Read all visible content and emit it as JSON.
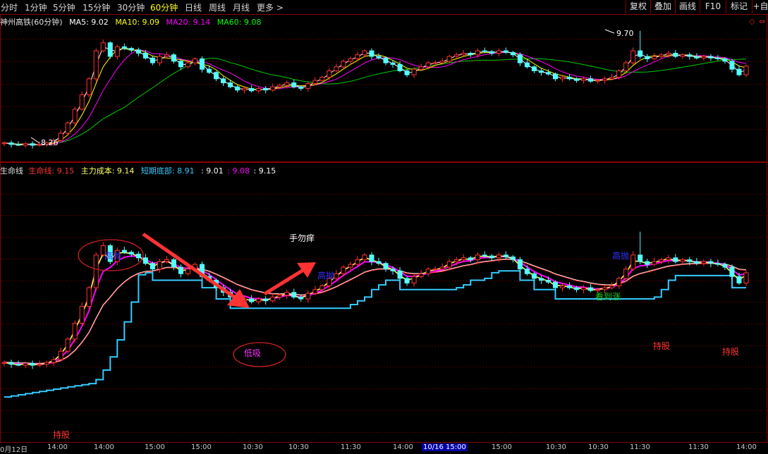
{
  "toolbar": {
    "tabs": [
      "分时",
      "1分钟",
      "5分钟",
      "15分钟",
      "30分钟",
      "60分钟",
      "日线",
      "周线",
      "月线",
      "更多 >"
    ],
    "active_tab": "60分钟",
    "buttons": [
      "复权",
      "叠加",
      "画线",
      "F10",
      "标记",
      "+自"
    ]
  },
  "price_panel": {
    "title": "神州高铁(60分钟)",
    "ma": [
      {
        "label": "MA5: 9.02",
        "color": "#ffffff"
      },
      {
        "label": "MA10: 9.09",
        "color": "#ffff00"
      },
      {
        "label": "MA20: 9.14",
        "color": "#ff00ff"
      },
      {
        "label": "MA60: 9.08",
        "color": "#00ff00"
      }
    ],
    "low_marker": "8.26",
    "high_marker": "9.70"
  },
  "indicator_panel": {
    "name": "生命线",
    "items": [
      {
        "label": "生命线: 9.15",
        "color": "#ff3333"
      },
      {
        "label": "主力成本: 9.14",
        "color": "#ffff66"
      },
      {
        "label": "短期底部: 8.91",
        "color": "#33ccff"
      },
      {
        "label": ": 9.01",
        "color": "#ffffff"
      },
      {
        "label": ": 9.08",
        "color": "#ff00ff"
      },
      {
        "label": ": 9.15",
        "color": "#ffffff"
      }
    ]
  },
  "annotations": {
    "high_sell_1": "高抛",
    "low_buy": "低吸",
    "high_sell_2": "高抛",
    "high_sell_3": "高抛",
    "dont_itch": "手勿痒",
    "see_rise": "看到涨",
    "hold_1": "持股",
    "hold_2": "持股",
    "hold_3": "持股"
  },
  "date_axis": [
    "0月12日",
    "14:00",
    "14:00",
    "15:00",
    "15:00",
    "10:30",
    "10:30",
    "11:30",
    "14:00",
    "10/16 15:00",
    "15:00",
    "10:30",
    "10:30",
    "11:30",
    "11:30",
    "14:00"
  ],
  "date_axis_highlight": "10/16 15:00",
  "colors": {
    "up": "#ff3232",
    "down": "#54ffff",
    "life": "#ff3333",
    "cost": "#ffff66",
    "support": "#33ccff",
    "ma20": "#ff00ff",
    "ma60": "#00cc00",
    "frame": "#8b0000",
    "arrow": "#ff3333"
  },
  "chart_data": {
    "type": "candlestick",
    "closes": [
      8.3,
      8.28,
      8.27,
      8.29,
      8.27,
      8.28,
      8.3,
      8.33,
      8.42,
      8.55,
      8.72,
      8.9,
      9.1,
      9.45,
      9.55,
      9.38,
      9.5,
      9.48,
      9.46,
      9.42,
      9.36,
      9.3,
      9.38,
      9.4,
      9.32,
      9.25,
      9.3,
      9.35,
      9.22,
      9.18,
      9.1,
      9.05,
      9.0,
      8.96,
      8.98,
      8.95,
      8.98,
      8.96,
      9.0,
      9.02,
      9.05,
      9.0,
      8.98,
      9.04,
      9.08,
      9.12,
      9.2,
      9.25,
      9.32,
      9.35,
      9.4,
      9.45,
      9.38,
      9.36,
      9.3,
      9.28,
      9.2,
      9.15,
      9.22,
      9.25,
      9.3,
      9.3,
      9.32,
      9.38,
      9.4,
      9.42,
      9.4,
      9.45,
      9.44,
      9.42,
      9.45,
      9.43,
      9.4,
      9.3,
      9.25,
      9.2,
      9.18,
      9.16,
      9.1,
      9.12,
      9.1,
      9.08,
      9.1,
      9.07,
      9.08,
      9.1,
      9.12,
      9.2,
      9.3,
      9.45,
      9.38,
      9.35,
      9.38,
      9.4,
      9.42,
      9.38,
      9.4,
      9.38,
      9.36,
      9.38,
      9.36,
      9.35,
      9.32,
      9.22,
      9.15,
      9.26
    ],
    "ma5_last": 9.02,
    "ma10_last": 9.09,
    "ma20_last": 9.14,
    "ma60_last": 9.08,
    "price_low": 8.26,
    "price_high": 9.7,
    "life_line_last": 9.15,
    "main_cost_last": 9.14,
    "short_bottom_last": 8.91,
    "x_labels": [
      "0月12日",
      "14:00",
      "14:00",
      "15:00",
      "15:00",
      "10:30",
      "10:30",
      "11:30",
      "14:00",
      "10/16 15:00",
      "15:00",
      "10:30",
      "10:30",
      "11:30",
      "11:30",
      "14:00"
    ]
  }
}
